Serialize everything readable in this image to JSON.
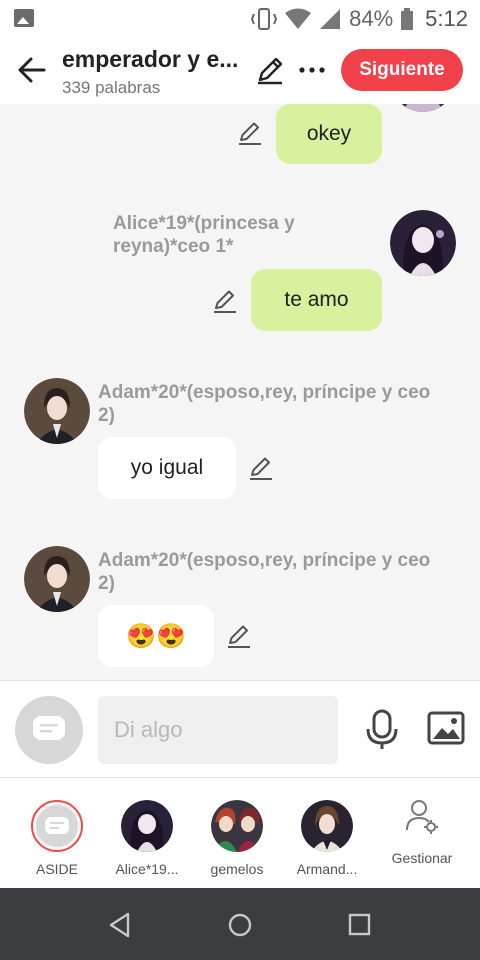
{
  "status_bar": {
    "battery": "84%",
    "time": "5:12"
  },
  "header": {
    "title": "emperador y e...",
    "subtitle": "339 palabras",
    "next_label": "Siguiente"
  },
  "messages": [
    {
      "sender": "",
      "text": "okey"
    },
    {
      "sender": "Alice*19*(princesa y reyna)*ceo 1*",
      "text": "te amo"
    },
    {
      "sender": "Adam*20*(esposo,rey, príncipe y ceo 2)",
      "text": "yo igual"
    },
    {
      "sender": "Adam*20*(esposo,rey, príncipe y ceo 2)",
      "text": "😍😍"
    }
  ],
  "input": {
    "placeholder": "Di algo"
  },
  "characters": [
    {
      "label": "ASIDE"
    },
    {
      "label": "Alice*19..."
    },
    {
      "label": "gemelos"
    },
    {
      "label": "Armand..."
    },
    {
      "label": "Gestionar"
    }
  ],
  "colors": {
    "accent": "#f2414a",
    "mine_bubble": "#d8f19e",
    "background": "#f5f5f5"
  }
}
